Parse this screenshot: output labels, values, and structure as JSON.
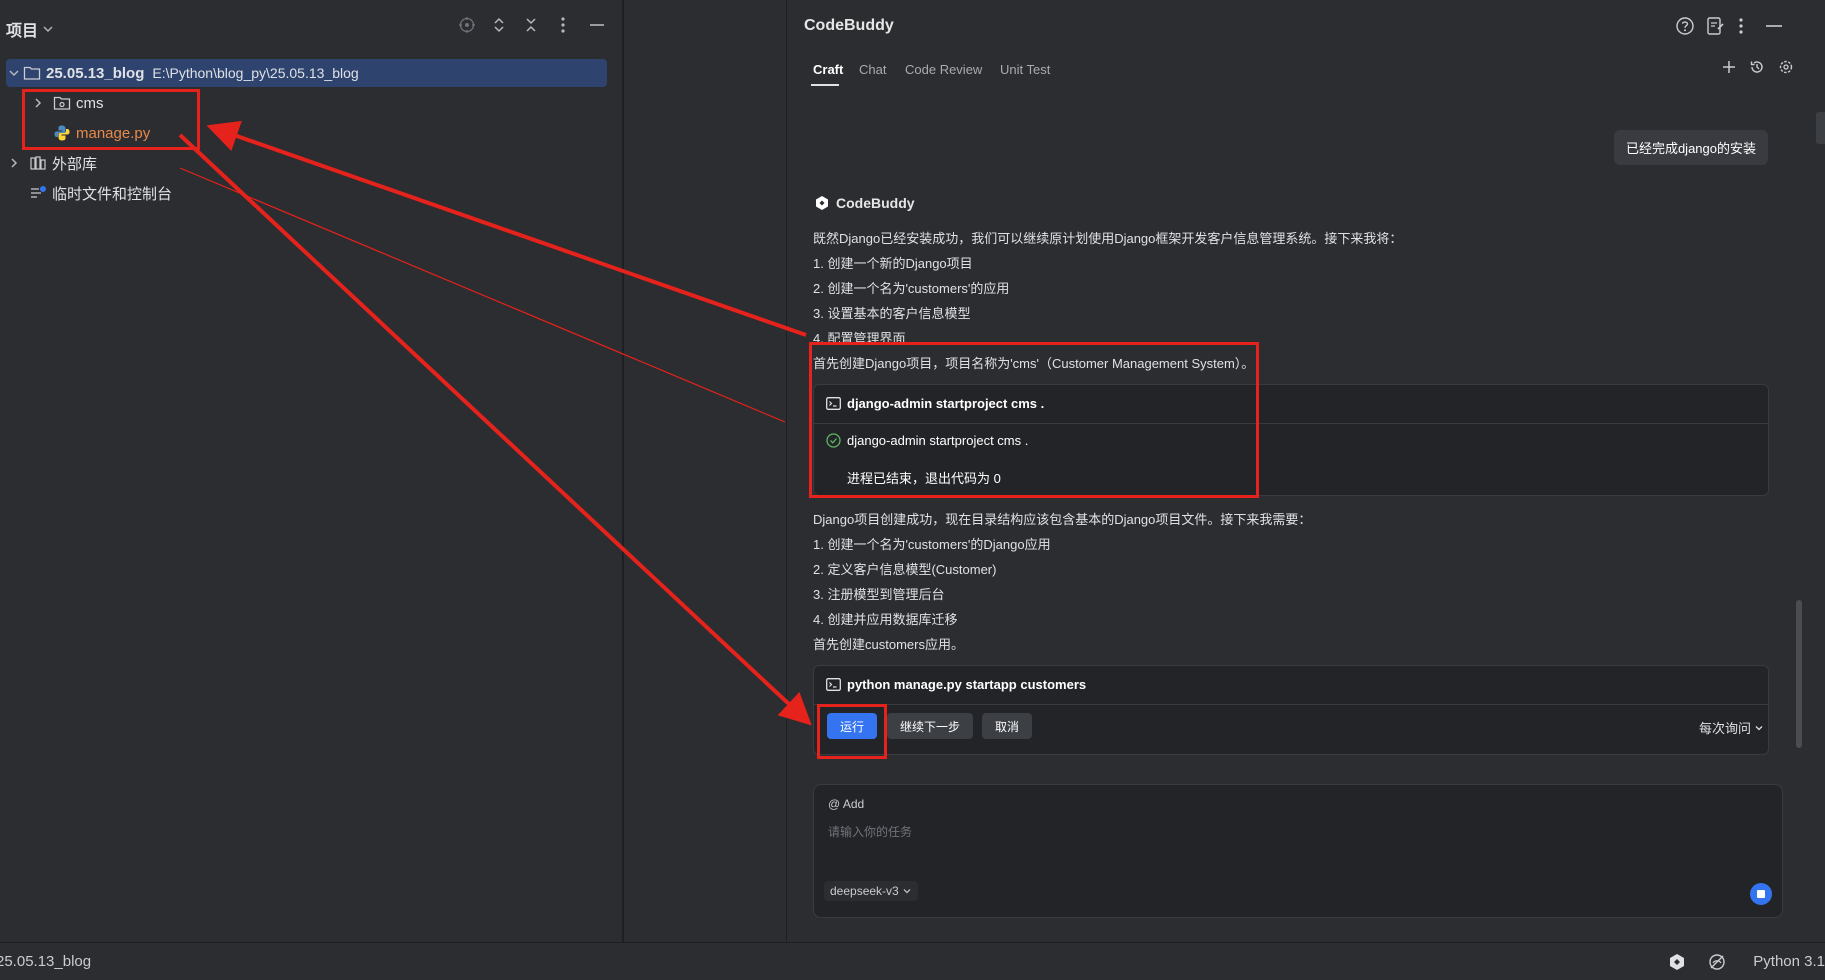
{
  "project_panel": {
    "title": "项目",
    "tree": {
      "root": {
        "name": "25.05.13_blog",
        "path": "E:\\Python\\blog_py\\25.05.13_blog"
      },
      "children": [
        {
          "label": "cms"
        },
        {
          "label": "manage.py"
        }
      ],
      "external_libs": "外部库",
      "scratches": "临时文件和控制台"
    }
  },
  "codebuddy": {
    "title": "CodeBuddy",
    "tabs": [
      "Craft",
      "Chat",
      "Code Review",
      "Unit Test"
    ],
    "user_message": "已经完成django的安装",
    "assistant_label": "CodeBuddy",
    "reply1": [
      "既然Django已经安装成功，我们可以继续原计划使用Django框架开发客户信息管理系统。接下来我将：",
      "1. 创建一个新的Django项目",
      "2. 创建一个名为'customers'的应用",
      "3. 设置基本的客户信息模型",
      "4. 配置管理界面",
      "首先创建Django项目，项目名称为'cms'（Customer Management System）。"
    ],
    "cmd1": {
      "command": "django-admin startproject cms .",
      "done_command": "django-admin startproject cms .",
      "result": "进程已结束，退出代码为 0"
    },
    "reply2": [
      "Django项目创建成功，现在目录结构应该包含基本的Django项目文件。接下来我需要：",
      "1. 创建一个名为'customers'的Django应用",
      "2. 定义客户信息模型(Customer)",
      "3. 注册模型到管理后台",
      "4. 创建并应用数据库迁移",
      "首先创建customers应用。"
    ],
    "cmd2": {
      "command": "python manage.py startapp customers",
      "run": "运行",
      "continue": "继续下一步",
      "cancel": "取消",
      "ask_mode": "每次询问"
    },
    "input": {
      "at_add": "@ Add",
      "placeholder": "请输入你的任务",
      "model": "deepseek-v3"
    }
  },
  "status_bar": {
    "path": "25.05.13_blog",
    "python": "Python 3.1"
  },
  "colors": {
    "accent_blue": "#3574f0",
    "annotation_red": "#e5221b",
    "selection": "#2e436e",
    "success_green": "#5fb865"
  }
}
